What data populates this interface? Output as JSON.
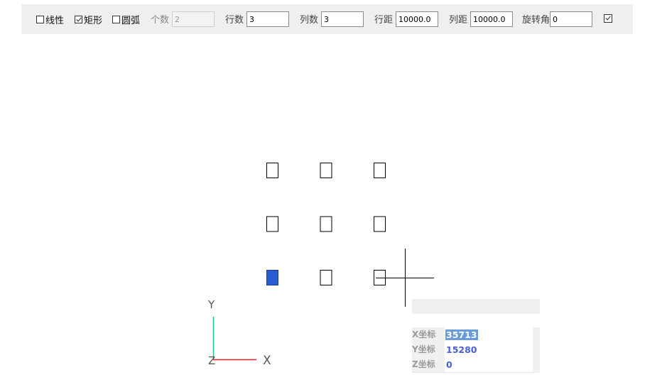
{
  "toolbar": {
    "options": [
      {
        "label": "线性",
        "checked": false
      },
      {
        "label": "矩形",
        "checked": true
      },
      {
        "label": "圆弧",
        "checked": false
      }
    ],
    "fields": {
      "count": {
        "label": "个数",
        "value": "2",
        "enabled": false
      },
      "rows": {
        "label": "行数",
        "value": "3"
      },
      "cols": {
        "label": "列数",
        "value": "3"
      },
      "row_spacing": {
        "label": "行距",
        "value": "10000.0"
      },
      "col_spacing": {
        "label": "列距",
        "value": "10000.0"
      },
      "rotation": {
        "label": "旋转角",
        "value": "0"
      }
    },
    "confirm_icon": "checkbox-confirm-icon"
  },
  "canvas": {
    "axes": {
      "y_label": "Y",
      "x_label": "X",
      "z_label": "Z",
      "x_color": "#e02020",
      "y_color": "#20c0a0"
    },
    "array": {
      "rows": 3,
      "cols": 3,
      "highlight": {
        "row": 3,
        "col": 1
      },
      "highlight_color": "#2b5bd0"
    }
  },
  "coordinates": {
    "x": {
      "label": "X坐标",
      "value": "35713"
    },
    "y": {
      "label": "Y坐标",
      "value": "15280"
    },
    "z": {
      "label": "Z坐标",
      "value": "0"
    }
  }
}
